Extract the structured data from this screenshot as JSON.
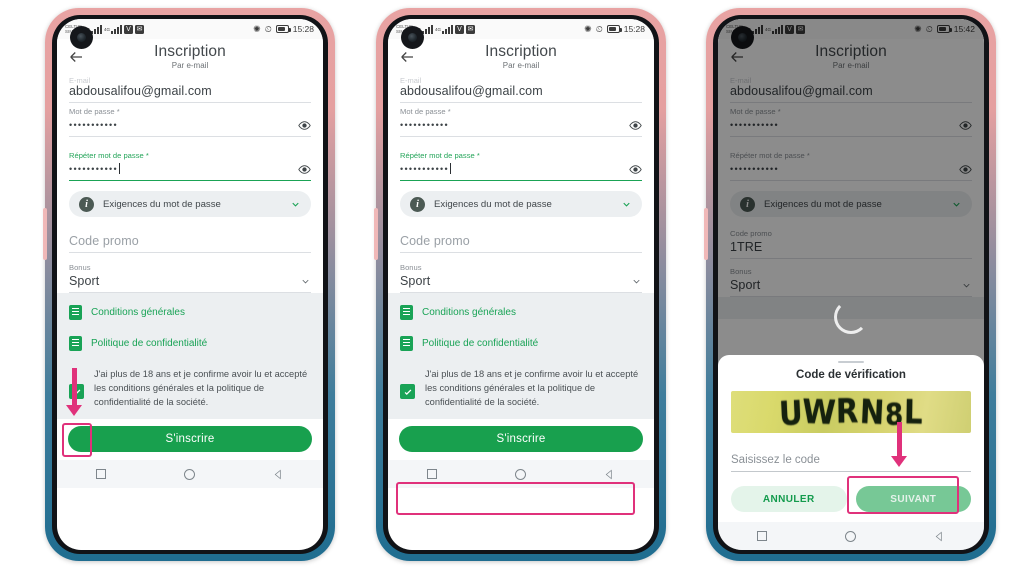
{
  "screen_title": "Inscription",
  "screen_subtitle": "Par e-mail",
  "status_bar": {
    "carrier_line1": "CELTIIS",
    "carrier_line2": "SIM",
    "time_1": "15:28",
    "time_2": "15:28",
    "time_3": "15:42",
    "sig_sup": "4G",
    "icon_shield": "shield-icon",
    "icon_mail": "mail-icon",
    "icon_bluetooth": "ᚫ",
    "icon_alarm": "⏱"
  },
  "form": {
    "email_label_clipped": "E-mail",
    "email_value": "abdousalifou@gmail.com",
    "password_label": "Mot de passe *",
    "password_value": "•••••••••••",
    "repeat_label": "Répéter mot de passe *",
    "repeat_value": "•••••••••••",
    "requirements_label": "Exigences du mot de passe",
    "promo_label": "Code promo",
    "promo_placeholder": "Code promo",
    "promo_value_p3": "1TRE",
    "promo_label_p3": "Code promo",
    "bonus_label": "Bonus",
    "bonus_value": "Sport"
  },
  "legal": {
    "terms_link": "Conditions générales",
    "privacy_link": "Politique de confidentialité",
    "consent_text": "J'ai plus de 18 ans et je confirme avoir lu et accepté les conditions générales et la politique de confidentialité de la société."
  },
  "cta": {
    "signup_label": "S'inscrire"
  },
  "dialog": {
    "title": "Code de vérification",
    "captcha_text": "UWRN8L",
    "captcha_chars": [
      "U",
      "W",
      "R",
      "N",
      "8",
      "L"
    ],
    "input_placeholder": "Saisissez le code",
    "cancel_label": "ANNULER",
    "next_label": "SUIVANT"
  },
  "colors": {
    "brand_green": "#18a04e",
    "link_green": "#19a356",
    "annotation_pink": "#e0317b",
    "legal_bg": "#eceff1"
  }
}
